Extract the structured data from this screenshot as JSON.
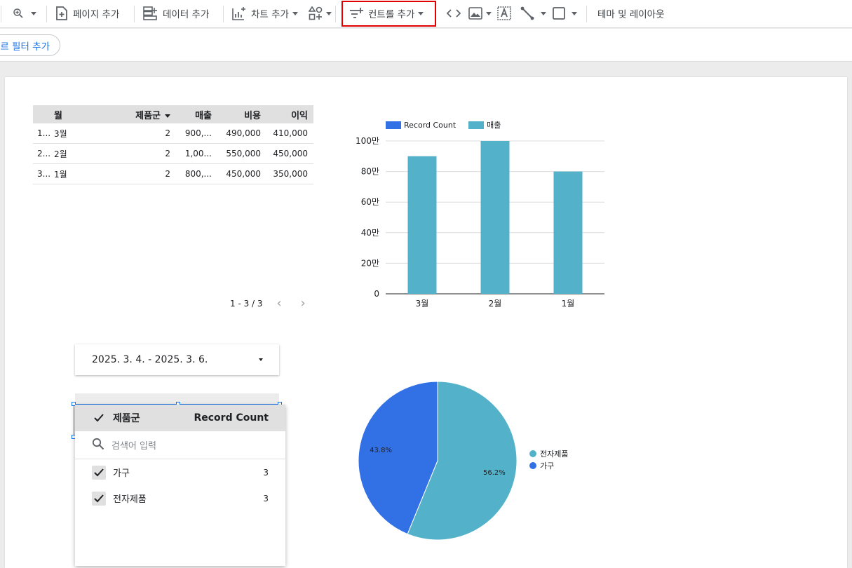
{
  "toolbar": {
    "add_page": "페이지 추가",
    "add_data": "데이터 추가",
    "add_chart": "차트 추가",
    "add_control": "컨트롤 추가",
    "theme_layout": "테마 및 레이아웃"
  },
  "filterbar": {
    "add_filter": "르 필터 추가"
  },
  "table": {
    "headers": {
      "month": "월",
      "group": "제품군",
      "sales": "매출",
      "cost": "비용",
      "profit": "이익"
    },
    "rows": [
      {
        "idx": "1...",
        "month": "3월",
        "group": "2",
        "sales": "900,...",
        "cost": "490,000",
        "profit": "410,000"
      },
      {
        "idx": "2...",
        "month": "2월",
        "group": "2",
        "sales": "1,00...",
        "cost": "550,000",
        "profit": "450,000"
      },
      {
        "idx": "3...",
        "month": "1월",
        "group": "2",
        "sales": "800,...",
        "cost": "450,000",
        "profit": "350,000"
      }
    ],
    "pager": "1 - 3 / 3"
  },
  "chart_data": [
    {
      "type": "bar",
      "categories": [
        "3월",
        "2월",
        "1월"
      ],
      "series": [
        {
          "name": "Record Count",
          "values": [
            2,
            2,
            2
          ],
          "color": "#3270e6"
        },
        {
          "name": "매출",
          "values": [
            900000,
            1000000,
            800000
          ],
          "color": "#53b2c9"
        }
      ],
      "ylim": [
        0,
        1000000
      ],
      "yticks": [
        "0",
        "20만",
        "40만",
        "60만",
        "80만",
        "100만"
      ],
      "legend_position": "top",
      "grid": true
    },
    {
      "type": "pie",
      "slices": [
        {
          "name": "전자제품",
          "value": 56.2,
          "label": "56.2%",
          "color": "#53b2c9"
        },
        {
          "name": "가구",
          "value": 43.8,
          "label": "43.8%",
          "color": "#3270e6"
        }
      ],
      "legend_position": "right"
    }
  ],
  "date_control": {
    "range": "2025. 3. 4. - 2025. 3. 6."
  },
  "dropdown": {
    "header_label": "제품군",
    "header_metric": "Record Count",
    "search_placeholder": "검색어 입력",
    "items": [
      {
        "label": "가구",
        "count": "3"
      },
      {
        "label": "전자제품",
        "count": "3"
      }
    ]
  }
}
